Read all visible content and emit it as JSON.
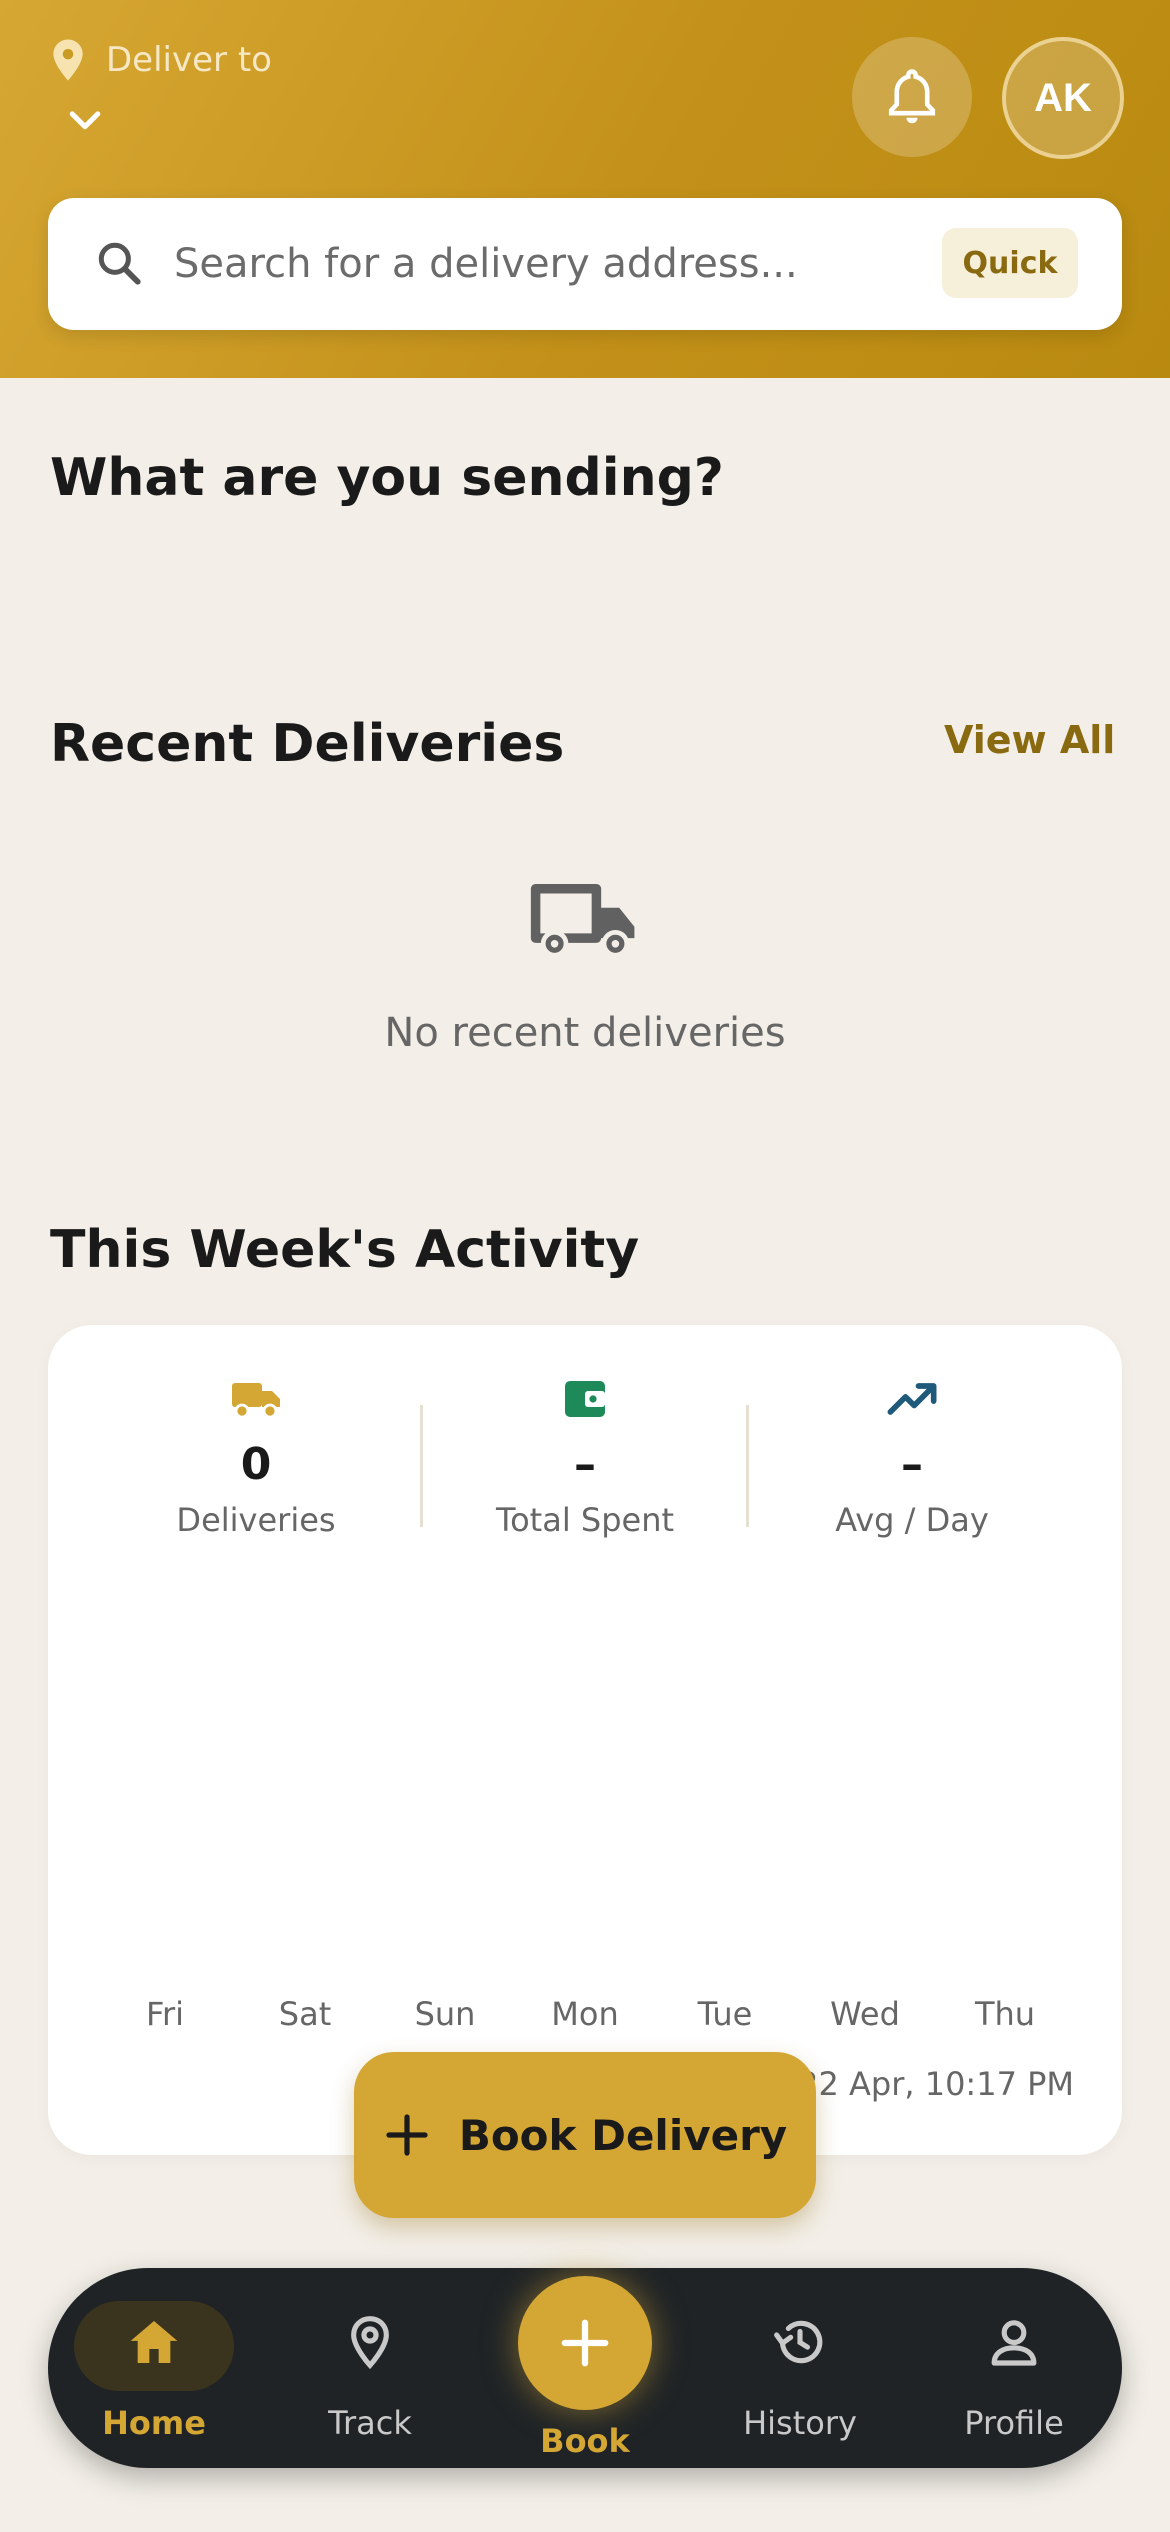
{
  "header": {
    "deliver_label": "Deliver to",
    "avatar_initials": "AK"
  },
  "search": {
    "placeholder": "Search for a delivery address...",
    "quick_label": "Quick"
  },
  "sections": {
    "sending_title": "What are you sending?",
    "recent_title": "Recent Deliveries",
    "view_all": "View All",
    "empty_text": "No recent deliveries",
    "activity_title": "This Week's Activity"
  },
  "stats": [
    {
      "icon": "truck-icon",
      "value": "0",
      "label": "Deliveries"
    },
    {
      "icon": "wallet-icon",
      "value": "–",
      "label": "Total Spent"
    },
    {
      "icon": "trending-up-icon",
      "value": "–",
      "label": "Avg / Day"
    }
  ],
  "chart": {
    "days": [
      "Fri",
      "Sat",
      "Sun",
      "Mon",
      "Tue",
      "Wed",
      "Thu"
    ],
    "updated": "22 Apr, 10:17 PM"
  },
  "book_button": {
    "label": "Book Delivery"
  },
  "nav": {
    "home": "Home",
    "track": "Track",
    "book": "Book",
    "history": "History",
    "profile": "Profile"
  },
  "colors": {
    "accent": "#d4a634",
    "accent_dark": "#8a6a10",
    "nav_bg": "#1f2326",
    "wallet_green": "#1e8a5a",
    "trend_blue": "#1f5a7a"
  }
}
